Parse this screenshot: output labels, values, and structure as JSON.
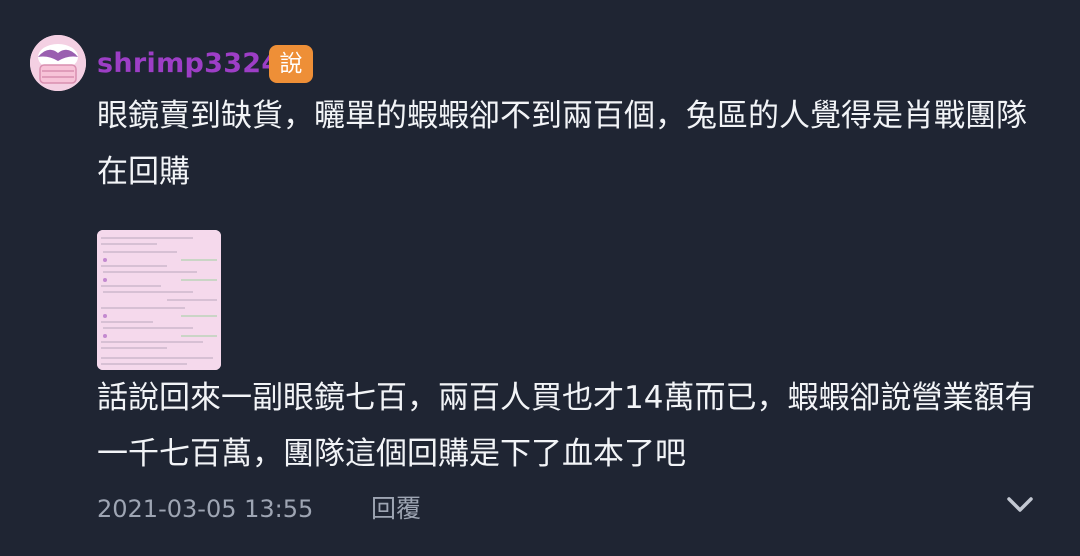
{
  "comment": {
    "author": {
      "username": "shrimp3324",
      "badge": "說",
      "avatar_icon": "masked-face-avatar",
      "username_color": "#9d3ec6",
      "badge_color": "#ee8f37"
    },
    "paragraph1": "眼鏡賣到缺貨，曬單的蝦蝦卻不到兩百個，兔區的人覺得是肖戰團隊在回購",
    "attachment_icon": "screenshot-thumbnail",
    "paragraph2": "話說回來一副眼鏡七百，兩百人買也才14萬而已，蝦蝦卻說營業額有一千七百萬，團隊這個回購是下了血本了吧",
    "timestamp": "2021-03-05 13:55",
    "reply_label": "回覆",
    "expand_icon": "chevron-down-icon"
  },
  "colors": {
    "background": "#1f2533",
    "text": "#f2f4f7",
    "meta": "#9ea5b3"
  }
}
